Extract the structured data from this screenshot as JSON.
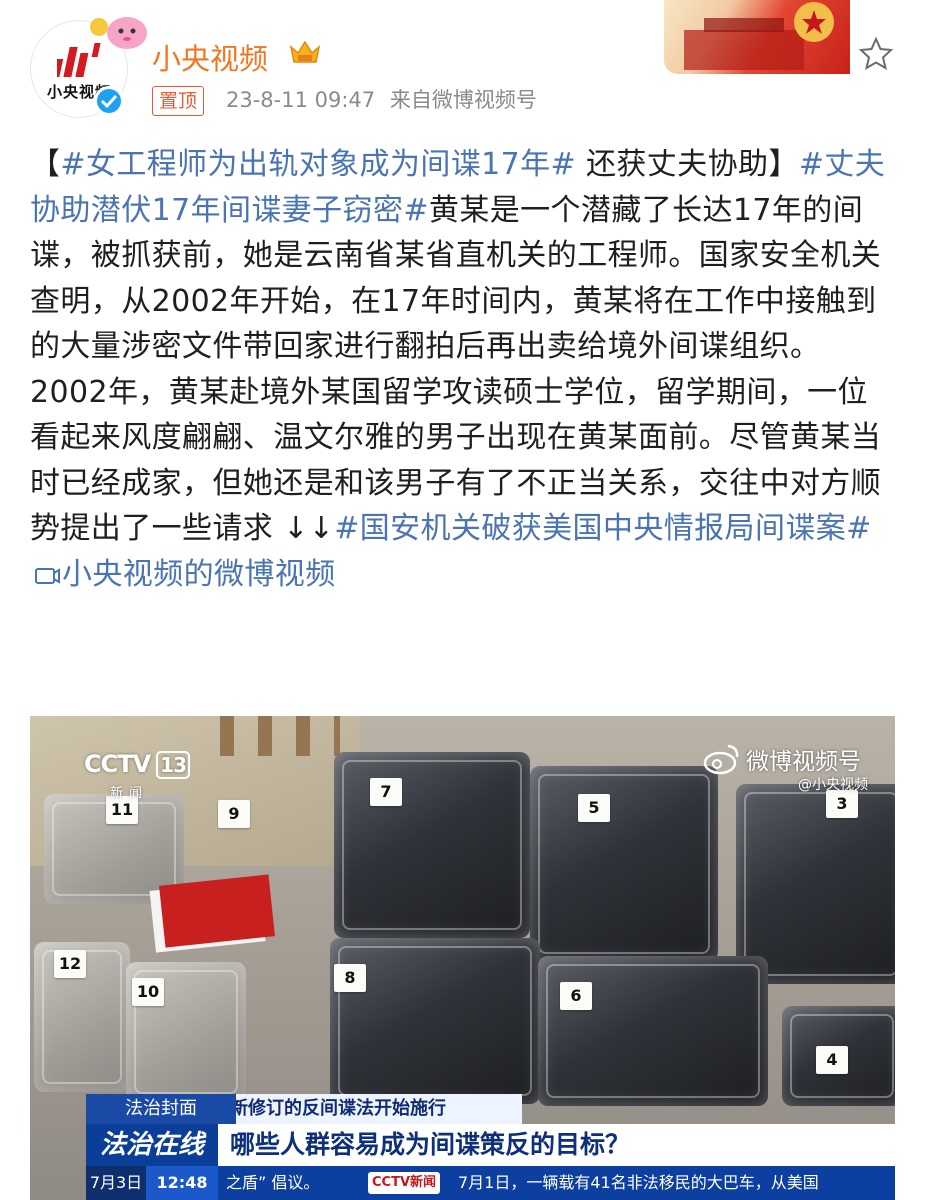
{
  "header": {
    "avatar_label": "小央视频",
    "username": "小央视频",
    "pin_label": "置顶",
    "timestamp": "23-8-11 09:47",
    "source": "来自微博视频号"
  },
  "post": {
    "seg_open": "【",
    "tag1": "#女工程师为出轨对象成为间谍17年#",
    "seg_a": " 还获丈夫协助】",
    "tag2": "#丈夫协助潜伏17年间谍妻子窃密#",
    "seg_b": "黄某是一个潜藏了长达17年的间谍，被抓获前，她是云南省某省直机关的工程师。国家安全机关查明，从2002年开始，在17年时间内，黄某将在工作中接触到的大量涉密文件带回家进行翻拍后再出卖给境外间谍组织。2002年，黄某赴境外某国留学攻读硕士学位，留学期间，一位看起来风度翩翩、温文尔雅的男子出现在黄某面前。尽管黄某当时已经成家，但她还是和该男子有了不正当关系，交往中对方顺势提出了一些请求",
    "arrows": " ↓↓",
    "tag3": "#国安机关破获美国中央情报局间谍案#",
    "link_label": "小央视频的微博视频"
  },
  "video": {
    "channel_logo": "CCTV",
    "channel_num": "13",
    "channel_sub": "新闻",
    "watermark": "微博视频号",
    "watermark_sub": "@小央视频",
    "evidence_numbers": [
      "11",
      "9",
      "7",
      "5",
      "3",
      "12",
      "10",
      "8",
      "6",
      "4"
    ],
    "program": "法治封面",
    "subtitle_small": "新修订的反间谍法开始施行",
    "brand": "法治在线",
    "headline": "哪些人群容易成为间谍策反的目标？",
    "ticker_date": "7月3日",
    "ticker_time": "12:48",
    "ticker_text1": "之盾” 倡议。",
    "ticker_logo": "CCTV新闻",
    "ticker_text2": "7月1日，一辆载有41名非法移民的大巴车，从美国"
  },
  "icons": {
    "star": "star-outline-icon",
    "crown": "member-crown-icon",
    "verified": "verified-check-icon",
    "play": "video-play-icon"
  },
  "colors": {
    "username": "#f2761e",
    "hashtag": "#4a74b2",
    "pin": "#e55b36",
    "meta": "#8a8a8a",
    "cctv_blue": "#0c3f9f"
  }
}
